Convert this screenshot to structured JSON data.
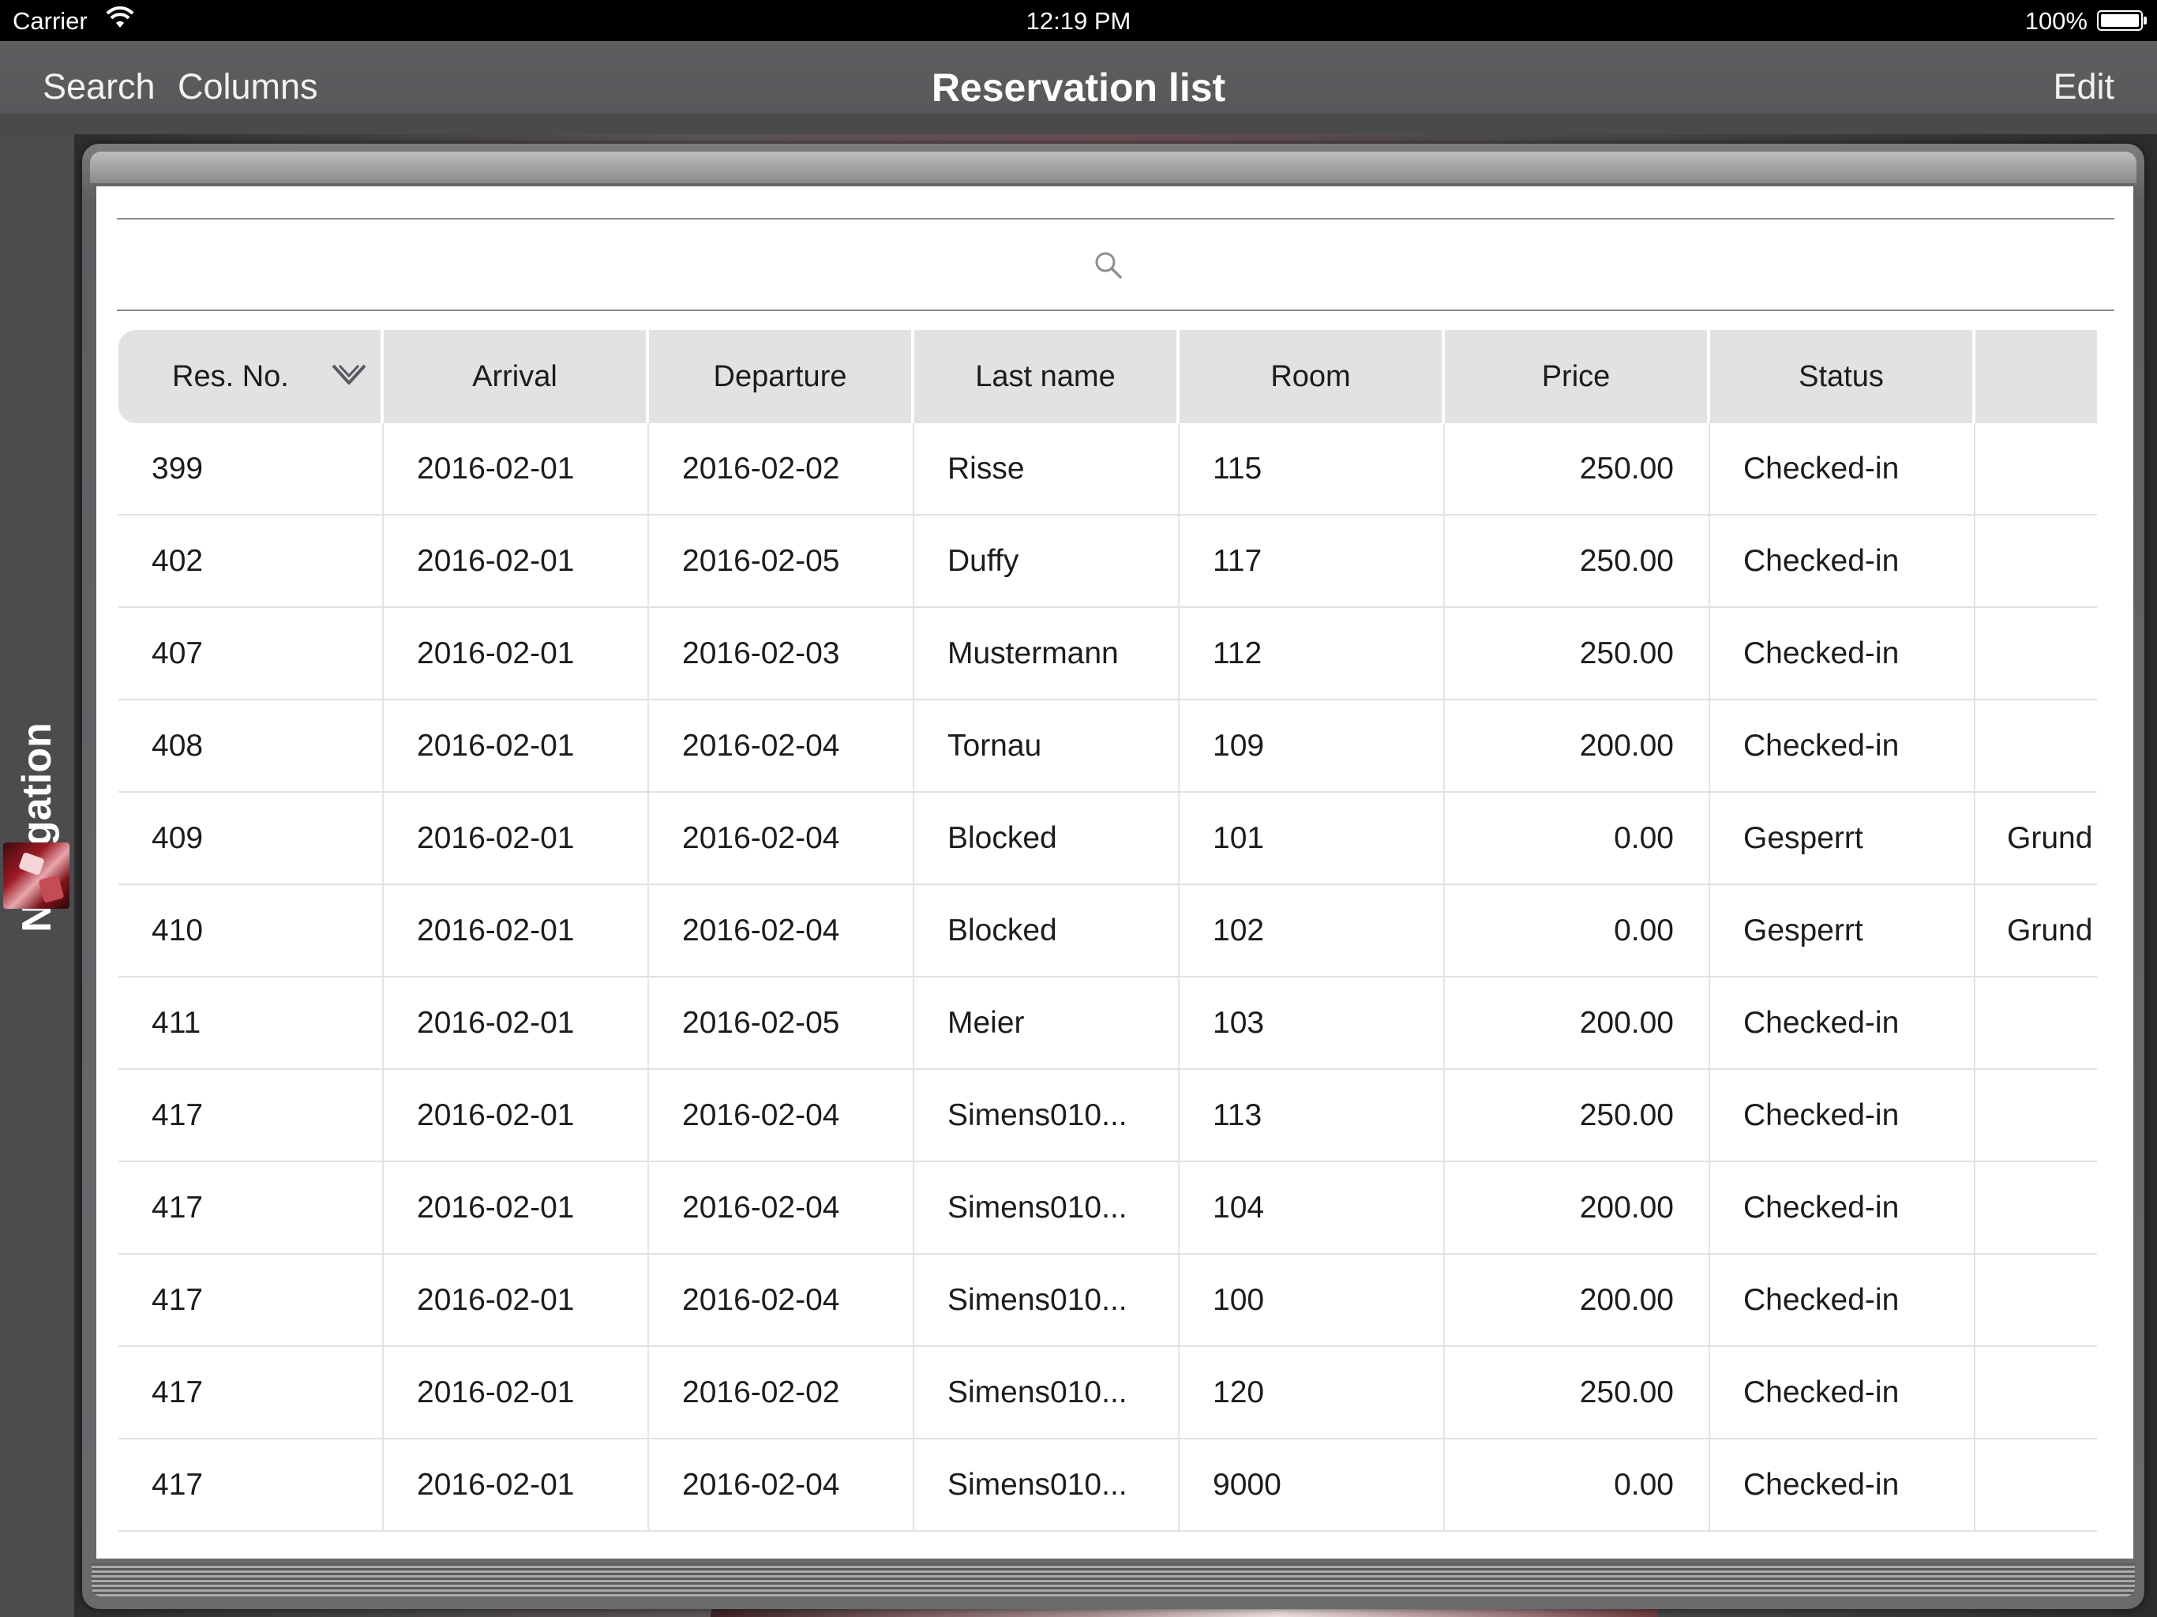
{
  "status_bar": {
    "carrier": "Carrier",
    "time": "12:19 PM",
    "battery": "100%"
  },
  "nav_bar": {
    "search": "Search",
    "columns": "Columns",
    "title": "Reservation list",
    "edit": "Edit"
  },
  "sidebar": {
    "label": "Navigation"
  },
  "search": {
    "placeholder": ""
  },
  "table": {
    "columns": [
      "Res. No.",
      "Arrival",
      "Departure",
      "Last name",
      "Room",
      "Price",
      "Status",
      ""
    ],
    "rows": [
      {
        "res_no": "399",
        "arrival": "2016-02-01",
        "departure": "2016-02-02",
        "last_name": "Risse",
        "room": "115",
        "price": "250.00",
        "status": "Checked-in",
        "extra": ""
      },
      {
        "res_no": "402",
        "arrival": "2016-02-01",
        "departure": "2016-02-05",
        "last_name": "Duffy",
        "room": "117",
        "price": "250.00",
        "status": "Checked-in",
        "extra": ""
      },
      {
        "res_no": "407",
        "arrival": "2016-02-01",
        "departure": "2016-02-03",
        "last_name": "Mustermann",
        "room": "112",
        "price": "250.00",
        "status": "Checked-in",
        "extra": ""
      },
      {
        "res_no": "408",
        "arrival": "2016-02-01",
        "departure": "2016-02-04",
        "last_name": "Tornau",
        "room": "109",
        "price": "200.00",
        "status": "Checked-in",
        "extra": ""
      },
      {
        "res_no": "409",
        "arrival": "2016-02-01",
        "departure": "2016-02-04",
        "last_name": "Blocked",
        "room": "101",
        "price": "0.00",
        "status": "Gesperrt",
        "extra": "Grund"
      },
      {
        "res_no": "410",
        "arrival": "2016-02-01",
        "departure": "2016-02-04",
        "last_name": "Blocked",
        "room": "102",
        "price": "0.00",
        "status": "Gesperrt",
        "extra": "Grund"
      },
      {
        "res_no": "411",
        "arrival": "2016-02-01",
        "departure": "2016-02-05",
        "last_name": "Meier",
        "room": "103",
        "price": "200.00",
        "status": "Checked-in",
        "extra": ""
      },
      {
        "res_no": "417",
        "arrival": "2016-02-01",
        "departure": "2016-02-04",
        "last_name": "Simens010...",
        "room": "113",
        "price": "250.00",
        "status": "Checked-in",
        "extra": ""
      },
      {
        "res_no": "417",
        "arrival": "2016-02-01",
        "departure": "2016-02-04",
        "last_name": "Simens010...",
        "room": "104",
        "price": "200.00",
        "status": "Checked-in",
        "extra": ""
      },
      {
        "res_no": "417",
        "arrival": "2016-02-01",
        "departure": "2016-02-04",
        "last_name": "Simens010...",
        "room": "100",
        "price": "200.00",
        "status": "Checked-in",
        "extra": ""
      },
      {
        "res_no": "417",
        "arrival": "2016-02-01",
        "departure": "2016-02-02",
        "last_name": "Simens010...",
        "room": "120",
        "price": "250.00",
        "status": "Checked-in",
        "extra": ""
      },
      {
        "res_no": "417",
        "arrival": "2016-02-01",
        "departure": "2016-02-04",
        "last_name": "Simens010...",
        "room": "9000",
        "price": "0.00",
        "status": "Checked-in",
        "extra": ""
      }
    ]
  },
  "colors": {
    "header_bg": "#e2e2e4",
    "nav_bar_bg": "#5e5e61",
    "row_separator": "#e1e1e3"
  },
  "icons": {
    "wifi": "wifi-icon",
    "battery": "battery-icon",
    "search": "search-icon",
    "sort": "chevron-down-icon",
    "thumbnail": "navigation-thumbnail"
  }
}
